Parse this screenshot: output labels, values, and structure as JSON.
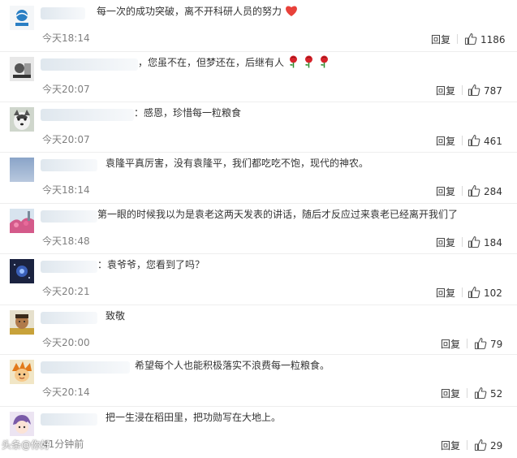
{
  "reply_label": "回复",
  "comments": [
    {
      "text": "每一次的成功突破，离不开科研人员的努力",
      "time": "今天18:14",
      "likes": "1186"
    },
    {
      "text": "，您虽不在，但梦还在，后继有人",
      "time": "今天20:07",
      "likes": "787"
    },
    {
      "text": "：感恩，珍惜每一粒粮食",
      "time": "今天20:07",
      "likes": "461"
    },
    {
      "text": "袁隆平真厉害，没有袁隆平，我们都吃吃不饱，现代的神农。",
      "time": "今天18:14",
      "likes": "284"
    },
    {
      "text": "第一眼的时候我以为是袁老这两天发表的讲话，随后才反应过来袁老已经离开我们了",
      "time": "今天18:48",
      "likes": "184"
    },
    {
      "text": "：袁爷爷，您看到了吗？",
      "time": "今天20:21",
      "likes": "102"
    },
    {
      "text": "致敬",
      "time": "今天20:00",
      "likes": "79"
    },
    {
      "text": "希望每个人也能积极落实不浪费每一粒粮食。",
      "time": "今天20:14",
      "likes": "52"
    },
    {
      "text": "把一生浸在稻田里，把功勋写在大地上。",
      "time": "41分钟前",
      "likes": "29"
    }
  ],
  "watermark": "头条@你好",
  "colors": {
    "heart": "#e8413a",
    "rose": "#d6232a",
    "time": "#808080",
    "text": "#333333"
  }
}
